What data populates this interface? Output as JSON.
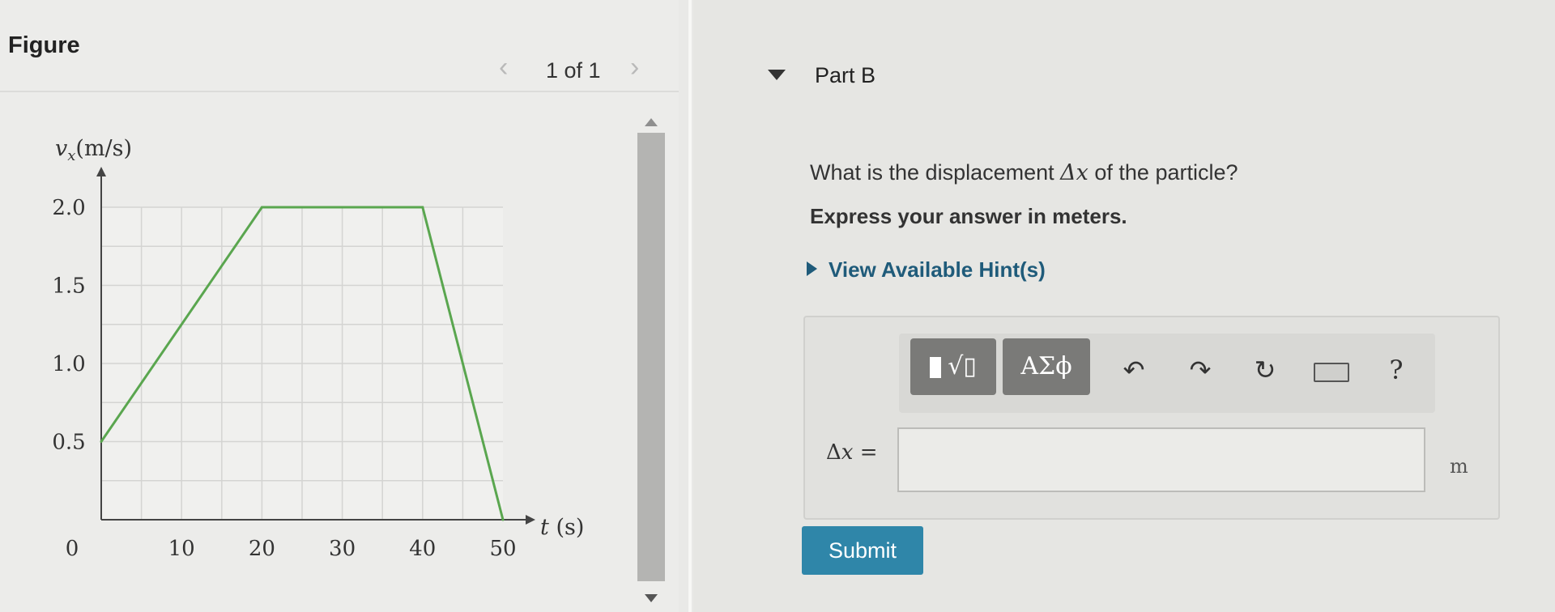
{
  "figure": {
    "title": "Figure",
    "pager": {
      "prev_icon": "chevron-left-icon",
      "count": "1 of 1",
      "next_icon": "chevron-right-icon"
    }
  },
  "chart_data": {
    "type": "line",
    "x": [
      0,
      20,
      40,
      50
    ],
    "series": [
      {
        "values": [
          0.5,
          2.0,
          2.0,
          0.0
        ]
      }
    ],
    "ylabel_var": "v",
    "ylabel_sub": "x",
    "ylabel_unit": "(m/s)",
    "xlabel_var": "t",
    "xlabel_unit": "(s)",
    "x_ticks": [
      "0",
      "10",
      "20",
      "30",
      "40",
      "50"
    ],
    "y_ticks": [
      "0.5",
      "1.0",
      "1.5",
      "2.0"
    ],
    "xlim": [
      0,
      50
    ],
    "ylim": [
      0,
      2.0
    ],
    "grid": true,
    "line_color": "#5aa64f"
  },
  "part": {
    "title": "Part B"
  },
  "question": {
    "prefix": "What is the displacement ",
    "symbol": "Δx",
    "suffix": " of the particle?",
    "instruction": "Express your answer in meters.",
    "hint": "View Available Hint(s)"
  },
  "toolbar": {
    "templates_label": "√▯",
    "symbols_label": "ΑΣϕ",
    "undo_icon": "↶",
    "redo_icon": "↷",
    "reset_icon": "↻",
    "help_label": "?"
  },
  "answer": {
    "label_delta": "Δ",
    "label_var": "x",
    "label_eq": " =",
    "value": "",
    "unit": "m"
  },
  "submit_label": "Submit"
}
